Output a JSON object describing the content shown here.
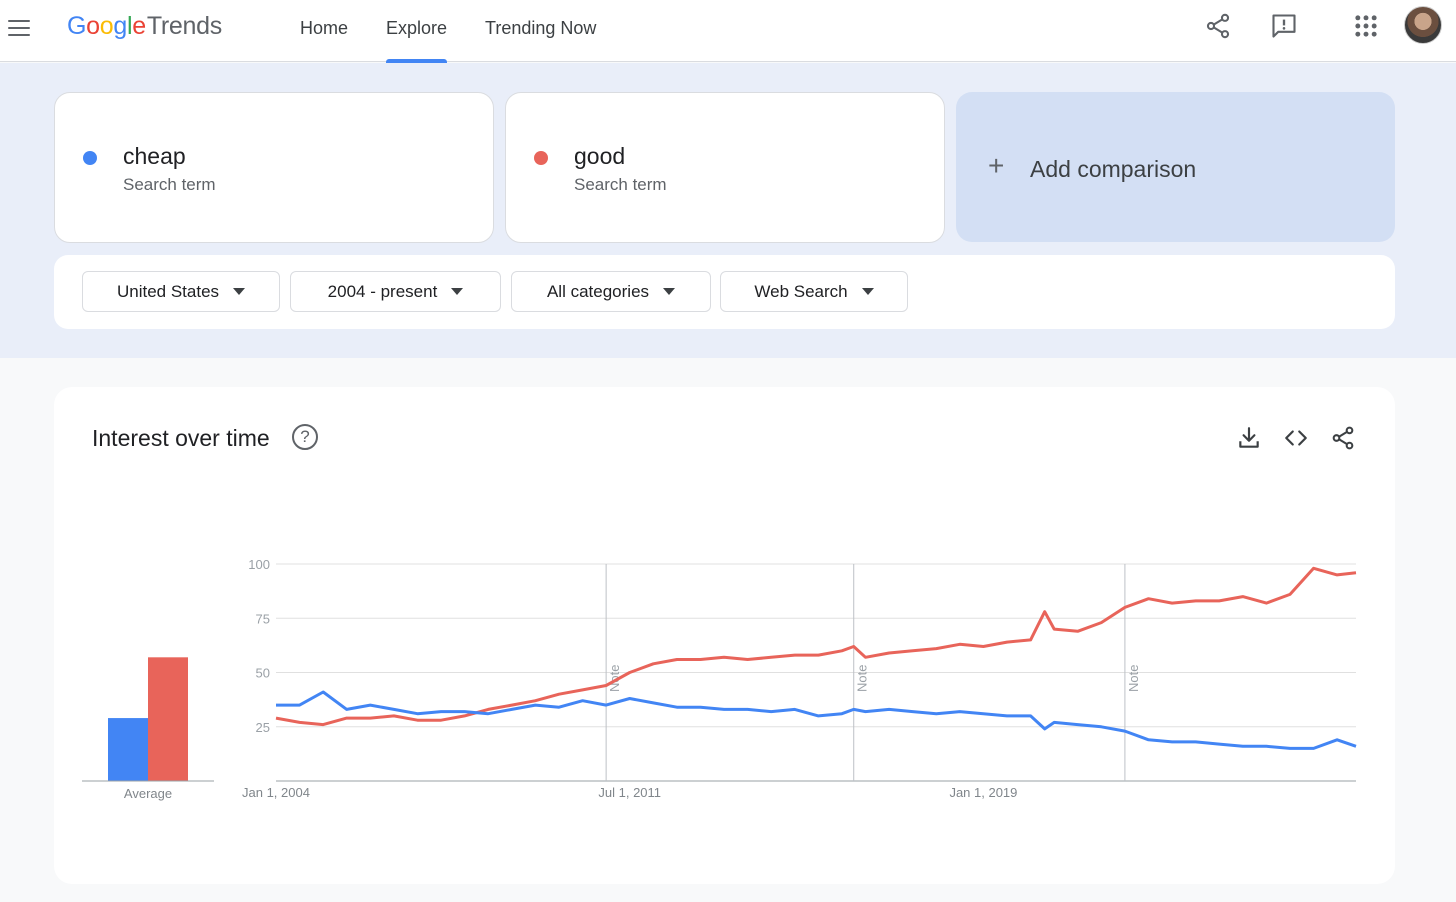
{
  "header": {
    "logo_google_letters": [
      "G",
      "o",
      "o",
      "g",
      "l",
      "e"
    ],
    "logo_trends": "Trends",
    "nav": [
      {
        "label": "Home",
        "active": false
      },
      {
        "label": "Explore",
        "active": true
      },
      {
        "label": "Trending Now",
        "active": false
      }
    ],
    "icons": [
      "menu-icon",
      "share-icon",
      "feedback-icon",
      "apps-icon",
      "avatar"
    ]
  },
  "terms": [
    {
      "name": "cheap",
      "subtitle": "Search term",
      "color": "#4285f4"
    },
    {
      "name": "good",
      "subtitle": "Search term",
      "color": "#e8645a"
    }
  ],
  "add_comparison": {
    "plus": "+",
    "label": "Add comparison"
  },
  "filters": [
    {
      "label": "United States"
    },
    {
      "label": "2004 - present"
    },
    {
      "label": "All categories"
    },
    {
      "label": "Web Search"
    }
  ],
  "chart_card": {
    "title": "Interest over time",
    "help": "?",
    "icons": [
      "download-icon",
      "embed-icon",
      "share-icon"
    ]
  },
  "chart_data": {
    "type": "line",
    "yticks": [
      25,
      50,
      75,
      100
    ],
    "ylim": [
      0,
      100
    ],
    "xtick_labels": [
      "Jan 1, 2004",
      "Jul 1, 2011",
      "Jan 1, 2019"
    ],
    "xtick_dates": [
      2004.0,
      2011.5,
      2019.0
    ],
    "xlim": [
      2004.0,
      2026.9
    ],
    "note_label": "Note",
    "note_dates": [
      2011.0,
      2016.25,
      2022.0
    ],
    "average": {
      "label": "Average",
      "values": [
        {
          "name": "cheap",
          "value": 29
        },
        {
          "name": "good",
          "value": 57
        }
      ]
    },
    "series": [
      {
        "name": "cheap",
        "color": "#4285f4",
        "points": [
          [
            2004.0,
            35
          ],
          [
            2004.5,
            35
          ],
          [
            2005.0,
            41
          ],
          [
            2005.5,
            33
          ],
          [
            2006.0,
            35
          ],
          [
            2006.5,
            33
          ],
          [
            2007.0,
            31
          ],
          [
            2007.5,
            32
          ],
          [
            2008.0,
            32
          ],
          [
            2008.5,
            31
          ],
          [
            2009.0,
            33
          ],
          [
            2009.5,
            35
          ],
          [
            2010.0,
            34
          ],
          [
            2010.5,
            37
          ],
          [
            2011.0,
            35
          ],
          [
            2011.5,
            38
          ],
          [
            2012.0,
            36
          ],
          [
            2012.5,
            34
          ],
          [
            2013.0,
            34
          ],
          [
            2013.5,
            33
          ],
          [
            2014.0,
            33
          ],
          [
            2014.5,
            32
          ],
          [
            2015.0,
            33
          ],
          [
            2015.5,
            30
          ],
          [
            2016.0,
            31
          ],
          [
            2016.25,
            33
          ],
          [
            2016.5,
            32
          ],
          [
            2017.0,
            33
          ],
          [
            2017.5,
            32
          ],
          [
            2018.0,
            31
          ],
          [
            2018.5,
            32
          ],
          [
            2019.0,
            31
          ],
          [
            2019.5,
            30
          ],
          [
            2020.0,
            30
          ],
          [
            2020.3,
            24
          ],
          [
            2020.5,
            27
          ],
          [
            2021.0,
            26
          ],
          [
            2021.5,
            25
          ],
          [
            2022.0,
            23
          ],
          [
            2022.5,
            19
          ],
          [
            2023.0,
            18
          ],
          [
            2023.5,
            18
          ],
          [
            2024.0,
            17
          ],
          [
            2024.5,
            16
          ],
          [
            2025.0,
            16
          ],
          [
            2025.5,
            15
          ],
          [
            2026.0,
            15
          ],
          [
            2026.5,
            19
          ],
          [
            2026.9,
            16
          ]
        ]
      },
      {
        "name": "good",
        "color": "#e8645a",
        "points": [
          [
            2004.0,
            29
          ],
          [
            2004.5,
            27
          ],
          [
            2005.0,
            26
          ],
          [
            2005.5,
            29
          ],
          [
            2006.0,
            29
          ],
          [
            2006.5,
            30
          ],
          [
            2007.0,
            28
          ],
          [
            2007.5,
            28
          ],
          [
            2008.0,
            30
          ],
          [
            2008.5,
            33
          ],
          [
            2009.0,
            35
          ],
          [
            2009.5,
            37
          ],
          [
            2010.0,
            40
          ],
          [
            2010.5,
            42
          ],
          [
            2011.0,
            44
          ],
          [
            2011.5,
            50
          ],
          [
            2012.0,
            54
          ],
          [
            2012.5,
            56
          ],
          [
            2013.0,
            56
          ],
          [
            2013.5,
            57
          ],
          [
            2014.0,
            56
          ],
          [
            2014.5,
            57
          ],
          [
            2015.0,
            58
          ],
          [
            2015.5,
            58
          ],
          [
            2016.0,
            60
          ],
          [
            2016.25,
            62
          ],
          [
            2016.5,
            57
          ],
          [
            2017.0,
            59
          ],
          [
            2017.5,
            60
          ],
          [
            2018.0,
            61
          ],
          [
            2018.5,
            63
          ],
          [
            2019.0,
            62
          ],
          [
            2019.5,
            64
          ],
          [
            2020.0,
            65
          ],
          [
            2020.3,
            78
          ],
          [
            2020.5,
            70
          ],
          [
            2021.0,
            69
          ],
          [
            2021.5,
            73
          ],
          [
            2022.0,
            80
          ],
          [
            2022.5,
            84
          ],
          [
            2023.0,
            82
          ],
          [
            2023.5,
            83
          ],
          [
            2024.0,
            83
          ],
          [
            2024.5,
            85
          ],
          [
            2025.0,
            82
          ],
          [
            2025.5,
            86
          ],
          [
            2026.0,
            98
          ],
          [
            2026.5,
            95
          ],
          [
            2026.9,
            96
          ]
        ]
      }
    ]
  }
}
